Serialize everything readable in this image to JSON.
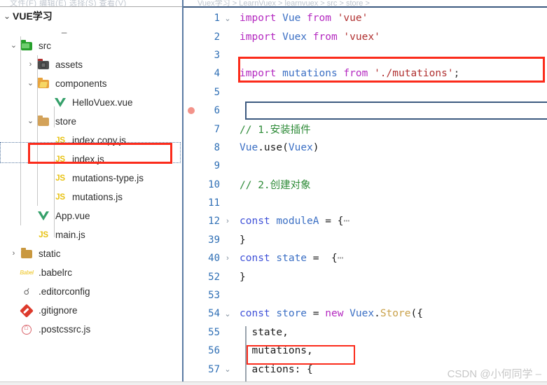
{
  "window": {
    "sidebar_ghost_text": "文件(F) 编辑(E) 选择(S) 查看(V)",
    "breadcrumb_text": "Vuex学习 > LearnVuex > learnvuex > src > store >"
  },
  "sidebar": {
    "project_title": "VUE学习",
    "project_chevron": "⌄",
    "dash_marker": "_",
    "items": [
      {
        "label": "src",
        "icon": "folder-green-icon",
        "twisty": "⌄",
        "indent": 1,
        "kind": "folder"
      },
      {
        "label": "assets",
        "icon": "folder-assets-icon",
        "twisty": "›",
        "indent": 2,
        "kind": "folder"
      },
      {
        "label": "components",
        "icon": "folder-orange-icon",
        "twisty": "⌄",
        "indent": 2,
        "kind": "folder"
      },
      {
        "label": "HelloVuex.vue",
        "icon": "vue-file-icon",
        "twisty": "",
        "indent": 3,
        "kind": "vue"
      },
      {
        "label": "store",
        "icon": "folder-tan-icon",
        "twisty": "⌄",
        "indent": 2,
        "kind": "folder"
      },
      {
        "label": "index copy.js",
        "icon": "js-file-icon",
        "twisty": "",
        "indent": 3,
        "kind": "js",
        "highlighted": true,
        "selected": true
      },
      {
        "label": "index.js",
        "icon": "js-file-icon",
        "twisty": "",
        "indent": 3,
        "kind": "js"
      },
      {
        "label": "mutations-type.js",
        "icon": "js-file-icon",
        "twisty": "",
        "indent": 3,
        "kind": "js"
      },
      {
        "label": "mutations.js",
        "icon": "js-file-icon",
        "twisty": "",
        "indent": 3,
        "kind": "js"
      },
      {
        "label": "App.vue",
        "icon": "vue-file-icon",
        "twisty": "",
        "indent": 2,
        "kind": "vue"
      },
      {
        "label": "main.js",
        "icon": "js-file-icon",
        "twisty": "",
        "indent": 2,
        "kind": "js"
      },
      {
        "label": "static",
        "icon": "folder-brown-icon",
        "twisty": "›",
        "indent": 1,
        "kind": "folder"
      },
      {
        "label": ".babelrc",
        "icon": "babel-file-icon",
        "twisty": "",
        "indent": 1,
        "kind": "babel"
      },
      {
        "label": ".editorconfig",
        "icon": "editorconfig-icon",
        "twisty": "",
        "indent": 1,
        "kind": "edc"
      },
      {
        "label": ".gitignore",
        "icon": "git-file-icon",
        "twisty": "",
        "indent": 1,
        "kind": "git"
      },
      {
        "label": ".postcssrc.js",
        "icon": "postcss-file-icon",
        "twisty": "",
        "indent": 1,
        "kind": "post"
      }
    ]
  },
  "editor": {
    "lines": [
      {
        "num": "1",
        "fold": "⌄",
        "bp": false,
        "tokens": [
          {
            "t": "import ",
            "c": "kw"
          },
          {
            "t": "Vue ",
            "c": "ident"
          },
          {
            "t": "from ",
            "c": "kw"
          },
          {
            "t": "'vue'",
            "c": "str"
          }
        ]
      },
      {
        "num": "2",
        "fold": "",
        "bp": false,
        "tokens": [
          {
            "t": "import ",
            "c": "kw"
          },
          {
            "t": "Vuex ",
            "c": "ident"
          },
          {
            "t": "from ",
            "c": "kw"
          },
          {
            "t": "'vuex'",
            "c": "str"
          }
        ]
      },
      {
        "num": "3",
        "fold": "",
        "bp": false,
        "tokens": []
      },
      {
        "num": "4",
        "fold": "",
        "bp": false,
        "highlight": "import-mutations",
        "tokens": [
          {
            "t": "import ",
            "c": "kw"
          },
          {
            "t": "mutations ",
            "c": "ident"
          },
          {
            "t": "from ",
            "c": "kw"
          },
          {
            "t": "'./mutations'",
            "c": "str"
          },
          {
            "t": ";",
            "c": "punc"
          }
        ]
      },
      {
        "num": "5",
        "fold": "",
        "bp": false,
        "tokens": []
      },
      {
        "num": "6",
        "fold": "",
        "bp": true,
        "selected": true,
        "tokens": []
      },
      {
        "num": "7",
        "fold": "",
        "bp": false,
        "tokens": [
          {
            "t": "// 1.安装插件",
            "c": "cmt"
          }
        ]
      },
      {
        "num": "8",
        "fold": "",
        "bp": false,
        "tokens": [
          {
            "t": "Vue",
            "c": "ident"
          },
          {
            "t": ".use(",
            "c": "plain"
          },
          {
            "t": "Vuex",
            "c": "ident"
          },
          {
            "t": ")",
            "c": "plain"
          }
        ]
      },
      {
        "num": "9",
        "fold": "",
        "bp": false,
        "tokens": []
      },
      {
        "num": "10",
        "fold": "",
        "bp": false,
        "tokens": [
          {
            "t": "// 2.创建对象",
            "c": "cmt"
          }
        ]
      },
      {
        "num": "11",
        "fold": "",
        "bp": false,
        "tokens": []
      },
      {
        "num": "12",
        "fold": "›",
        "bp": false,
        "tokens": [
          {
            "t": "const ",
            "c": "kw2"
          },
          {
            "t": "moduleA ",
            "c": "ident"
          },
          {
            "t": "= ",
            "c": "plain"
          },
          {
            "t": "{",
            "c": "plain"
          },
          {
            "t": "⋯",
            "c": "ellip"
          }
        ]
      },
      {
        "num": "39",
        "fold": "",
        "bp": false,
        "tokens": [
          {
            "t": "}",
            "c": "plain"
          }
        ]
      },
      {
        "num": "40",
        "fold": "›",
        "bp": false,
        "tokens": [
          {
            "t": "const ",
            "c": "kw2"
          },
          {
            "t": "state ",
            "c": "ident"
          },
          {
            "t": "=  ",
            "c": "plain"
          },
          {
            "t": "{",
            "c": "plain"
          },
          {
            "t": "⋯",
            "c": "ellip"
          }
        ]
      },
      {
        "num": "52",
        "fold": "",
        "bp": false,
        "tokens": [
          {
            "t": "}",
            "c": "plain"
          }
        ]
      },
      {
        "num": "53",
        "fold": "",
        "bp": false,
        "tokens": []
      },
      {
        "num": "54",
        "fold": "⌄",
        "bp": false,
        "tokens": [
          {
            "t": "const ",
            "c": "kw2"
          },
          {
            "t": "store ",
            "c": "ident"
          },
          {
            "t": "= ",
            "c": "plain"
          },
          {
            "t": "new ",
            "c": "kw"
          },
          {
            "t": "Vuex",
            "c": "ident"
          },
          {
            "t": ".",
            "c": "plain"
          },
          {
            "t": "Store",
            "c": "cls"
          },
          {
            "t": "({",
            "c": "plain"
          }
        ]
      },
      {
        "num": "55",
        "fold": "",
        "bp": false,
        "indent_guide": true,
        "tokens": [
          {
            "t": "  state,",
            "c": "plain"
          }
        ]
      },
      {
        "num": "56",
        "fold": "",
        "bp": false,
        "indent_guide": true,
        "highlight": "mutations-key",
        "tokens": [
          {
            "t": "  mutations,",
            "c": "plain"
          }
        ]
      },
      {
        "num": "57",
        "fold": "⌄",
        "bp": false,
        "indent_guide": true,
        "tokens": [
          {
            "t": "  actions: {",
            "c": "plain"
          }
        ]
      }
    ]
  },
  "watermark": {
    "text": "CSDN @小何同学 –"
  },
  "colors": {
    "highlight_red": "#fb2b1b",
    "selection_blue": "#3d5a80",
    "breakpoint": "#f3938a",
    "keyword": "#b429c0",
    "const_keyword": "#3f51d8",
    "identifier": "#3b6fc4",
    "string": "#b03030",
    "comment": "#2e8b38",
    "class_name": "#c9a14a",
    "line_number": "#2f6fb5"
  }
}
